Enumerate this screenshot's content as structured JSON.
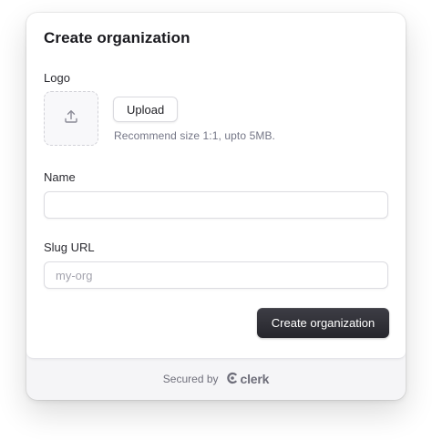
{
  "dialog": {
    "title": "Create organization",
    "logo_label": "Logo",
    "upload_label": "Upload",
    "upload_hint": "Recommend size 1:1, upto 5MB.",
    "upload_icon": "upload-icon",
    "name_label": "Name",
    "name_value": "",
    "slug_label": "Slug URL",
    "slug_placeholder": "my-org",
    "slug_value": "",
    "submit_label": "Create organization"
  },
  "footer": {
    "secured_text": "Secured by",
    "brand_name": "clerk",
    "brand_icon": "clerk-logo-icon"
  },
  "colors": {
    "primary_button": "#2f2f35",
    "footer_bg": "#f5f5f7",
    "muted_text": "#747686"
  }
}
